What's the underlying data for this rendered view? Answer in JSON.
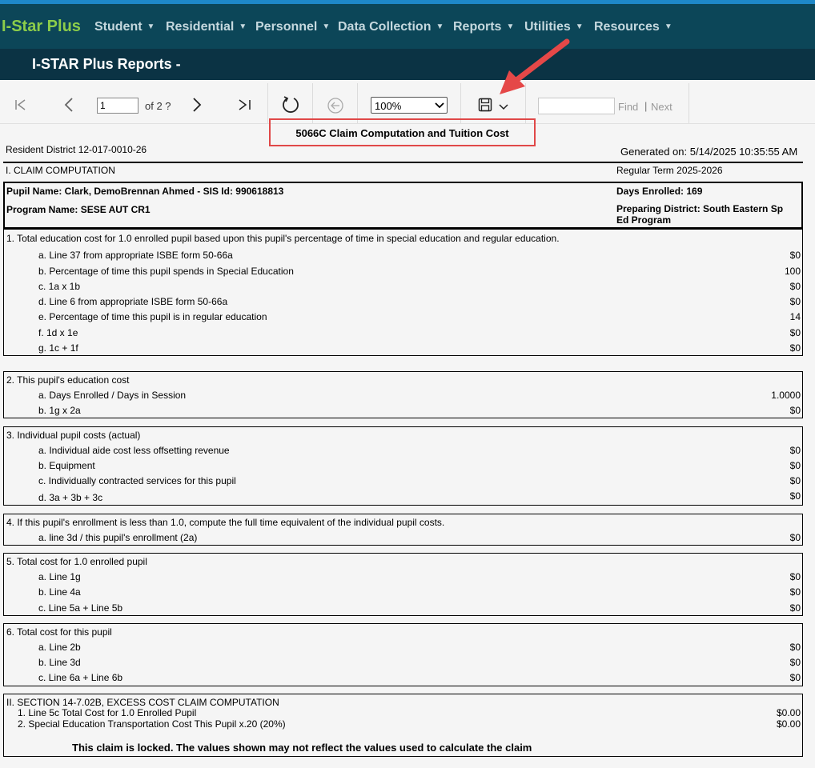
{
  "nav": {
    "brand": "I-Star Plus",
    "menus": [
      "Student",
      "Residential",
      "Personnel",
      "Data Collection",
      "Reports",
      "Utilities",
      "Resources"
    ]
  },
  "page_title": "I-STAR Plus Reports -",
  "toolbar": {
    "page_value": "1",
    "page_of": "of 2 ?",
    "zoom": "100%",
    "find_label": "Find",
    "pipe": "|",
    "next_label": "Next"
  },
  "report": {
    "title": "5066C Claim Computation and Tuition Cost",
    "resident_district": "Resident District  12-017-0010-26",
    "generated_on": "Generated on: 5/14/2025 10:35:55 AM",
    "section1_heading": "I. CLAIM COMPUTATION",
    "term": "Regular Term   2025-2026",
    "pupil_name": "Pupil Name:  Clark, DemoBrennan Ahmed  - SIS Id:  990618813",
    "days_enrolled": "Days Enrolled:  169",
    "program_name": "Program Name:  SESE AUT CR1",
    "preparing_district_1": "Preparing District:  South Eastern Sp",
    "preparing_district_2": "Ed Program",
    "s1": {
      "heading": "1. Total education cost for 1.0 enrolled pupil based upon this pupil's percentage of time in special education and regular education.",
      "rows": [
        {
          "label": "a. Line 37 from appropriate ISBE form 50-66a",
          "value": "$0"
        },
        {
          "label": "b. Percentage of time this pupil spends in Special Education",
          "value": "100"
        },
        {
          "label": "c. 1a x 1b",
          "value": "$0"
        },
        {
          "label": "d. Line 6 from appropriate ISBE form 50-66a",
          "value": "$0"
        },
        {
          "label": "e. Percentage of time this pupil is in regular education",
          "value": "14"
        },
        {
          "label": "f. 1d x 1e",
          "value": "$0"
        },
        {
          "label": "g. 1c + 1f",
          "value": "$0"
        }
      ]
    },
    "s2": {
      "heading": "2.  This pupil's education cost",
      "rows": [
        {
          "label": "a. Days Enrolled / Days in Session",
          "value": "1.0000"
        },
        {
          "label": "b. 1g x 2a",
          "value": "$0"
        }
      ]
    },
    "s3": {
      "heading": "3.  Individual pupil costs (actual)",
      "rows": [
        {
          "label": "a. Individual aide cost less offsetting revenue",
          "value": "$0"
        },
        {
          "label": "b. Equipment",
          "value": "$0"
        },
        {
          "label": "c. Individually contracted services for this pupil",
          "value": "$0"
        },
        {
          "label": "d. 3a + 3b + 3c",
          "value": "$0"
        }
      ]
    },
    "s4": {
      "heading": "4.  If this pupil's enrollment is less than 1.0, compute the full time equivalent of the individual pupil costs.",
      "rows": [
        {
          "label": "a. line 3d / this pupil's enrollment (2a)",
          "value": "$0"
        }
      ]
    },
    "s5": {
      "heading": "5.  Total cost for 1.0 enrolled pupil",
      "rows": [
        {
          "label": "a. Line 1g",
          "value": "$0"
        },
        {
          "label": "b. Line 4a",
          "value": "$0"
        },
        {
          "label": "c. Line 5a + Line 5b",
          "value": "$0"
        }
      ]
    },
    "s6": {
      "heading": "6.  Total cost for this pupil",
      "rows": [
        {
          "label": "a. Line 2b",
          "value": "$0"
        },
        {
          "label": "b. Line 3d",
          "value": "$0"
        },
        {
          "label": "c. Line 6a + Line 6b",
          "value": "$0"
        }
      ]
    },
    "s7": {
      "heading": "II. SECTION 14-7.02B, EXCESS COST CLAIM COMPUTATION",
      "rows": [
        {
          "label": "1. Line 5c Total Cost for 1.0 Enrolled Pupil",
          "value": "$0.00"
        },
        {
          "label": "2. Special Education Transportation Cost This Pupil x.20 (20%)",
          "value": "$0.00"
        }
      ],
      "locked_note": "This claim is locked.  The values shown may not reflect the values used to calculate the claim"
    }
  },
  "colors": {
    "nav_bg": "#0c4658",
    "title_bg": "#0b3344",
    "brand": "#8ccd4a",
    "highlight": "#e04848",
    "arrow": "#e54848"
  }
}
